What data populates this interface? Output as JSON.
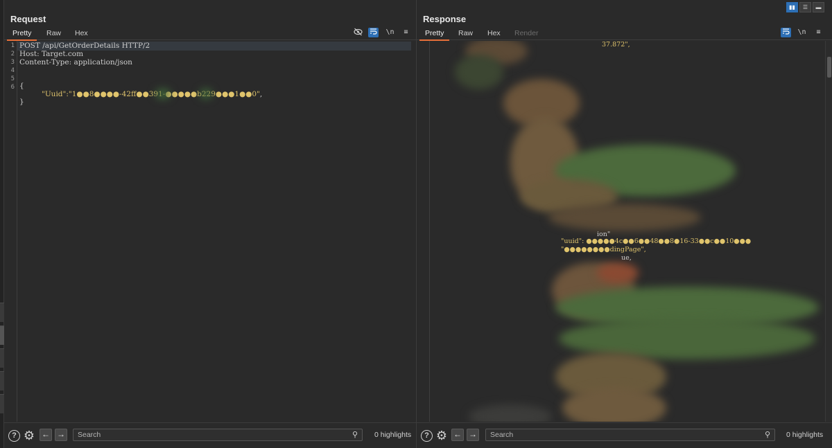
{
  "request": {
    "title": "Request",
    "tabs": [
      "Pretty",
      "Raw",
      "Hex"
    ],
    "tools": {
      "hide_icon": "eye-slash-icon",
      "wrap_icon": "wrap-icon",
      "newline_label": "\\n",
      "menu_label": "≡"
    },
    "line_numbers": [
      "1",
      "2",
      "3",
      "4",
      "5",
      "6"
    ],
    "lines": [
      "POST /api/GetOrderDetails HTTP/2",
      "Host: Target.com",
      "Content-Type: application/json",
      "",
      "",
      "{"
    ],
    "body_key": "\"Uuid\":",
    "body_value": "\"1●●8●●●●-42ff●●391-●●●●●b229●●●1●●0\"",
    "body_trail": ",",
    "body_close": "}",
    "search_placeholder": "Search",
    "highlights": "0 highlights"
  },
  "response": {
    "title": "Response",
    "tabs": [
      "Pretty",
      "Raw",
      "Hex",
      "Render"
    ],
    "tools": {
      "wrap_icon": "wrap-icon",
      "newline_label": "\\n",
      "menu_label": "≡"
    },
    "visible_fragments": {
      "line1": "37.872\",",
      "uuid_key": "\"uuid\":",
      "uuid_value": "●●●●●4c●●6●●48●●8●16-33●●c●●10●●●",
      "landing": "\"●●●●●●●●dingPage\",",
      "frag1": "ion\"",
      "frag2": "ue,"
    },
    "search_placeholder": "Search",
    "highlights": "0 highlights"
  },
  "layout_toggle": {
    "icons": [
      "columns-icon",
      "rows-icon",
      "tabs-icon"
    ],
    "glyphs": [
      "▮▮",
      "☰",
      "▬"
    ]
  },
  "colors": {
    "accent_tab": "#e8703a",
    "toggle_on": "#2d6fb5",
    "string": "#e0c46c"
  }
}
